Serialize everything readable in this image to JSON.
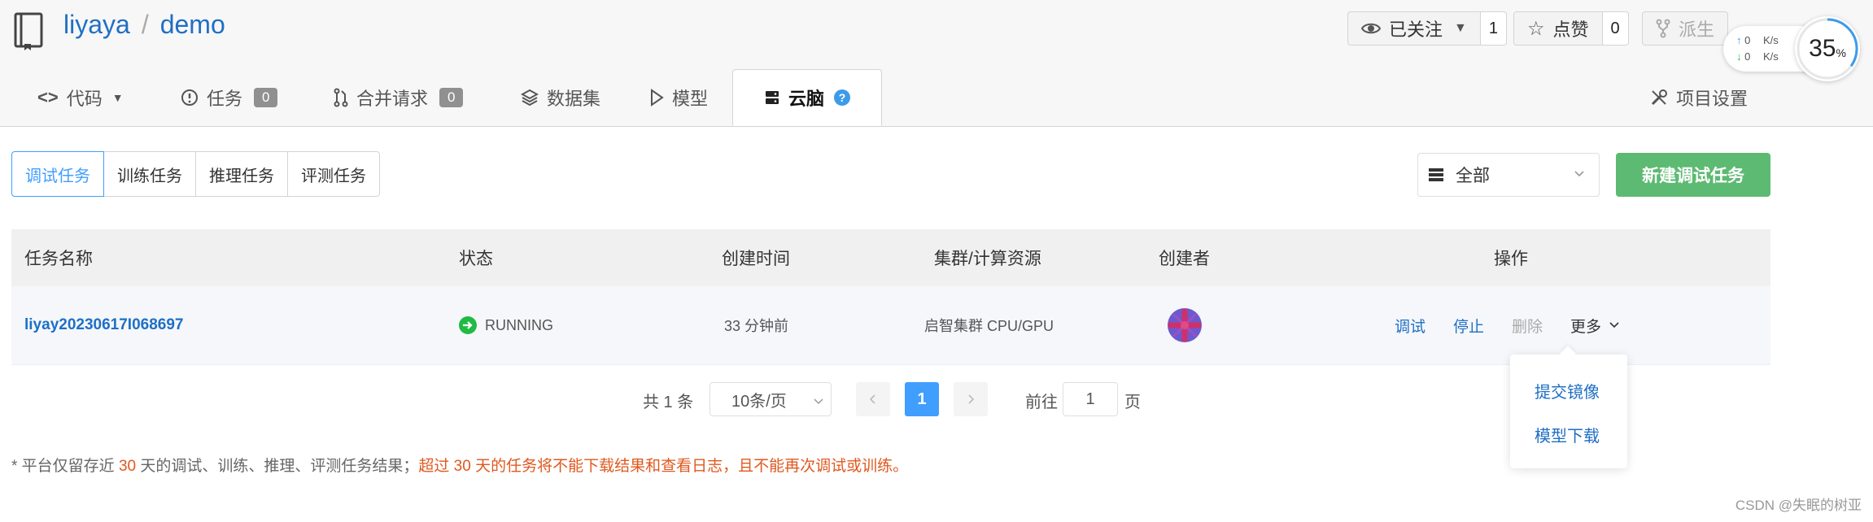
{
  "repo": {
    "owner": "liyaya",
    "sep": "/",
    "name": "demo"
  },
  "header_buttons": {
    "watch": {
      "label": "已关注",
      "count": "1"
    },
    "star": {
      "label": "点赞",
      "count": "0"
    },
    "fork": {
      "label": "派生"
    }
  },
  "speed_widget": {
    "up": "0",
    "down": "0",
    "unit": "K/s",
    "percent": "35",
    "percent_sign": "%"
  },
  "tabs": [
    {
      "label": "代码"
    },
    {
      "label": "任务",
      "count": "0"
    },
    {
      "label": "合并请求",
      "count": "0"
    },
    {
      "label": "数据集"
    },
    {
      "label": "模型"
    },
    {
      "label": "云脑"
    },
    {
      "label": "项目设置"
    }
  ],
  "task_types": [
    "调试任务",
    "训练任务",
    "推理任务",
    "评测任务"
  ],
  "filter": {
    "value": "全部"
  },
  "new_button": {
    "label": "新建调试任务"
  },
  "table": {
    "headers": [
      "任务名称",
      "状态",
      "创建时间",
      "集群/计算资源",
      "创建者",
      "操作"
    ],
    "row": {
      "name": "liyay20230617I068697",
      "status": "RUNNING",
      "created": "33 分钟前",
      "resource": "启智集群 CPU/GPU",
      "actions": {
        "debug": "调试",
        "stop": "停止",
        "delete": "删除",
        "more": "更多"
      }
    }
  },
  "pagination": {
    "total": "共 1 条",
    "page_size": "10条/页",
    "current": "1",
    "goto_label": "前往",
    "goto_value": "1",
    "page_suffix": "页"
  },
  "more_menu": [
    "提交镜像",
    "模型下载"
  ],
  "note": {
    "prefix": "* 平台仅留存近 ",
    "days1": "30",
    "mid": " 天的调试、训练、推理、评测任务结果；",
    "warn": "超过 30 天的任务将不能下载结果和查看日志，且不能再次调试或训练。"
  },
  "watermark": "CSDN @失眠的树亚",
  "colors": {
    "link": "#1f6fc5",
    "primary": "#409eff",
    "success": "#5dba72",
    "warn": "#e0581f",
    "status_running": "#21ba45"
  }
}
